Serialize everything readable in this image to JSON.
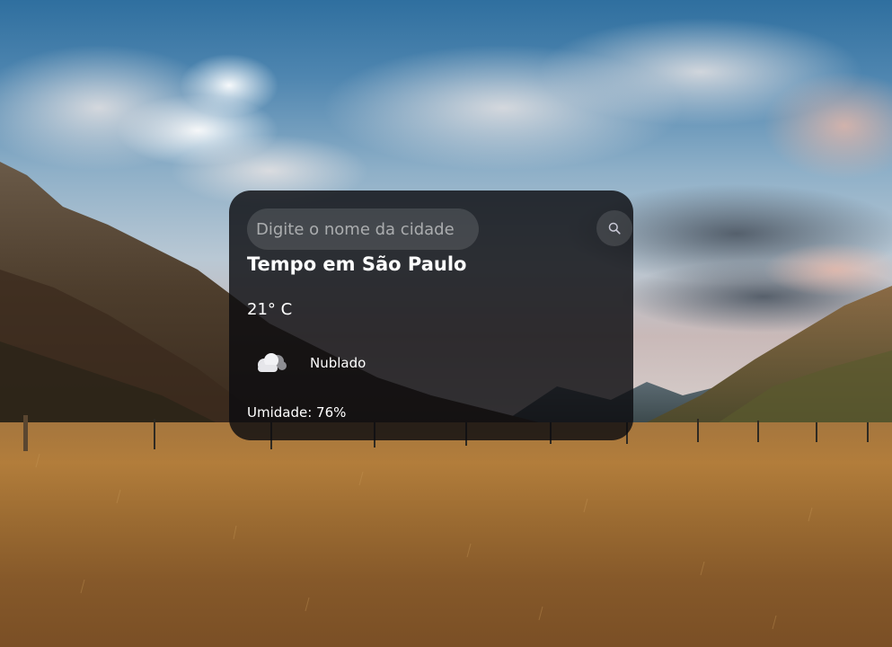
{
  "search": {
    "placeholder": "Digite o nome da cidade",
    "icon": "search-icon"
  },
  "weather": {
    "title": "Tempo em São Paulo",
    "temperature": "21° C",
    "icon": "cloud-icon",
    "description": "Nublado",
    "humidity": "Umidade: 76%"
  },
  "colors": {
    "card_background": "#0c0c10",
    "text": "#ffffff"
  }
}
